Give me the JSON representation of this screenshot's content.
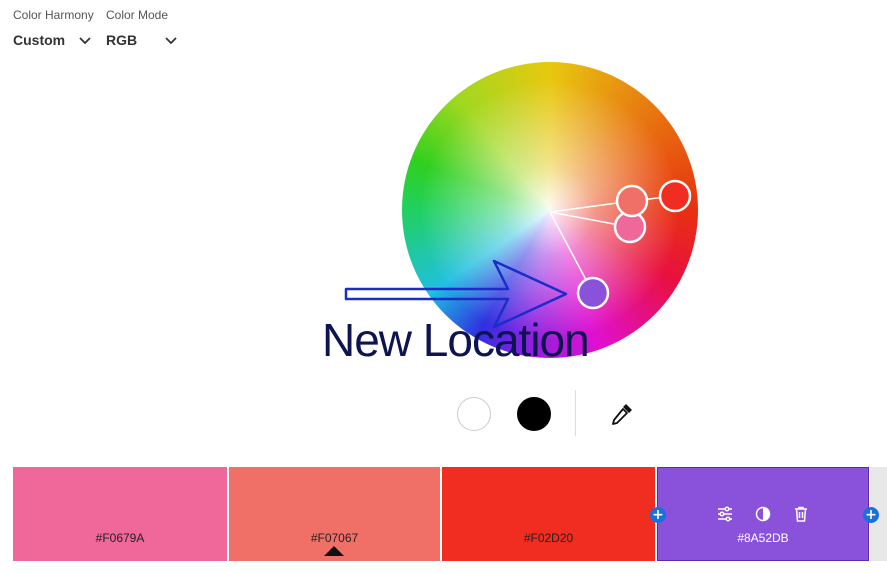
{
  "controls": {
    "harmony": {
      "label": "Color Harmony",
      "value": "Custom",
      "icon": "chevron-down-icon"
    },
    "mode": {
      "label": "Color Mode",
      "value": "RGB",
      "icon": "chevron-down-icon"
    }
  },
  "wheel": {
    "markers": [
      {
        "name": "marker-1",
        "color": "#F07067"
      },
      {
        "name": "marker-2",
        "color": "#F02D20"
      },
      {
        "name": "marker-3",
        "color": "#F0679A"
      },
      {
        "name": "marker-4",
        "color": "#8A52DB"
      }
    ]
  },
  "quick_swatches": {
    "white": "#FFFFFF",
    "black": "#000000",
    "eyedropper_icon": "eyedropper-icon"
  },
  "palette": [
    {
      "hex": "#F0679A",
      "color": "#F0679A"
    },
    {
      "hex": "#F07067",
      "color": "#F07067",
      "base": true
    },
    {
      "hex": "#F02D20",
      "color": "#F02D20"
    },
    {
      "hex": "#8A52DB",
      "color": "#8A52DB",
      "selected": true,
      "tools": [
        "sliders-icon",
        "contrast-icon",
        "trash-icon"
      ]
    }
  ],
  "add_icon": "+",
  "annotation": {
    "text": "New Location",
    "color": "#0D1450",
    "arrow_color": "#1A2DC8"
  }
}
